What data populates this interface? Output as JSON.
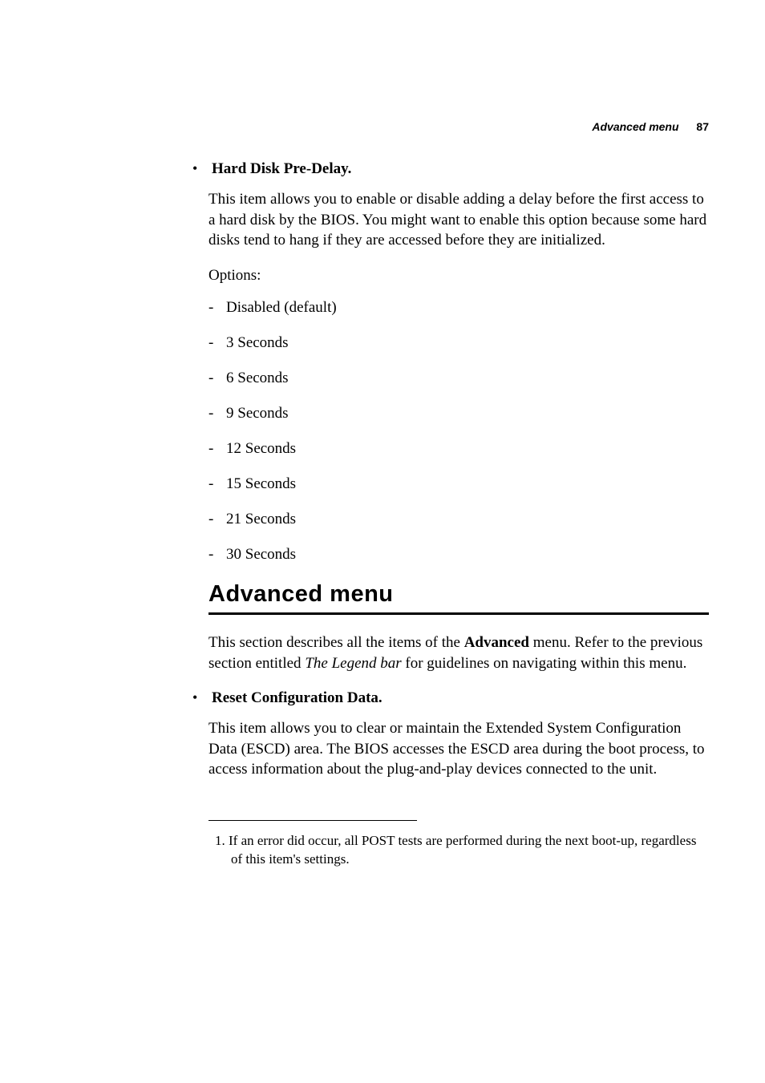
{
  "header": {
    "title": "Advanced menu",
    "page": "87"
  },
  "hard_disk_predelay": {
    "title": "Hard Disk Pre-Delay.",
    "desc": "This item allows you to enable or disable adding a delay before the first access to a hard disk by the BIOS. You might want to enable this option because some hard disks tend to hang if they are accessed before they are initialized.",
    "options_label": "Options:",
    "options": [
      "Disabled (default)",
      "3 Seconds",
      "6 Seconds",
      "9 Seconds",
      "12 Seconds",
      "15 Seconds",
      "21 Seconds",
      "30 Seconds"
    ]
  },
  "advanced_menu": {
    "heading": "Advanced menu",
    "intro_pre": "This section describes all the items of the ",
    "intro_bold": "Advanced",
    "intro_mid": " menu. Refer to the previous section entitled ",
    "intro_ital": "The Legend bar",
    "intro_post": " for guidelines on navigating within this menu."
  },
  "reset_config": {
    "title": "Reset Configuration Data.",
    "desc": "This item allows you to clear or maintain the Extended System Configuration Data (ESCD) area. The BIOS accesses the ESCD area during the boot process, to access information about the plug-and-play devices connected to the unit."
  },
  "footnote": {
    "marker": "1.",
    "text": "If an error did occur, all POST tests are performed during the next boot-up, regardless of this item's settings."
  }
}
